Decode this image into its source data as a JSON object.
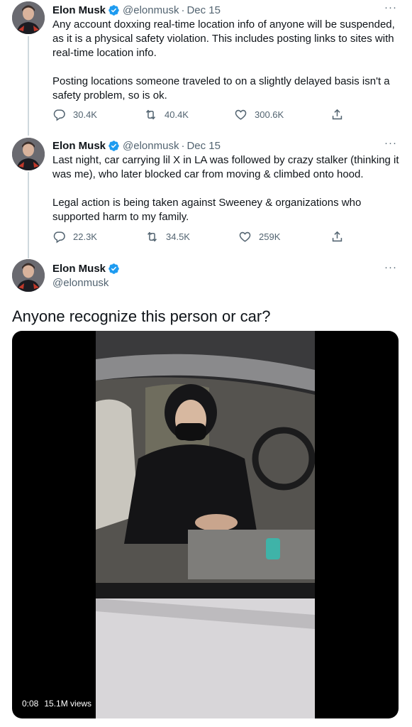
{
  "colors": {
    "verified": "#1d9bf0",
    "thread_line": "#cfd9de",
    "secondary_text": "#536471"
  },
  "tweets": [
    {
      "author": {
        "name": "Elon Musk",
        "handle": "@elonmusk"
      },
      "separator": "·",
      "date": "Dec 15",
      "more_label": "···",
      "paragraphs": [
        "Any account doxxing real-time location info of anyone will be suspended, as it is a physical safety violation. This includes posting links to sites with real-time location info.",
        "Posting locations someone traveled to on a slightly delayed basis isn't a safety problem, so is ok."
      ],
      "actions": {
        "replies": "30.4K",
        "retweets": "40.4K",
        "likes": "300.6K"
      }
    },
    {
      "author": {
        "name": "Elon Musk",
        "handle": "@elonmusk"
      },
      "separator": "·",
      "date": "Dec 15",
      "more_label": "···",
      "paragraphs": [
        "Last night, car carrying lil X in LA was followed by crazy stalker (thinking it was me), who later blocked car from moving & climbed onto hood.",
        "Legal action is being taken against Sweeney & organizations who supported harm to my family."
      ],
      "actions": {
        "replies": "22.3K",
        "retweets": "34.5K",
        "likes": "259K"
      }
    }
  ],
  "main_tweet": {
    "author": {
      "name": "Elon Musk",
      "handle": "@elonmusk"
    },
    "more_label": "···",
    "text": "Anyone recognize this person or car?",
    "video": {
      "time": "0:08",
      "views": "15.1M views"
    }
  }
}
